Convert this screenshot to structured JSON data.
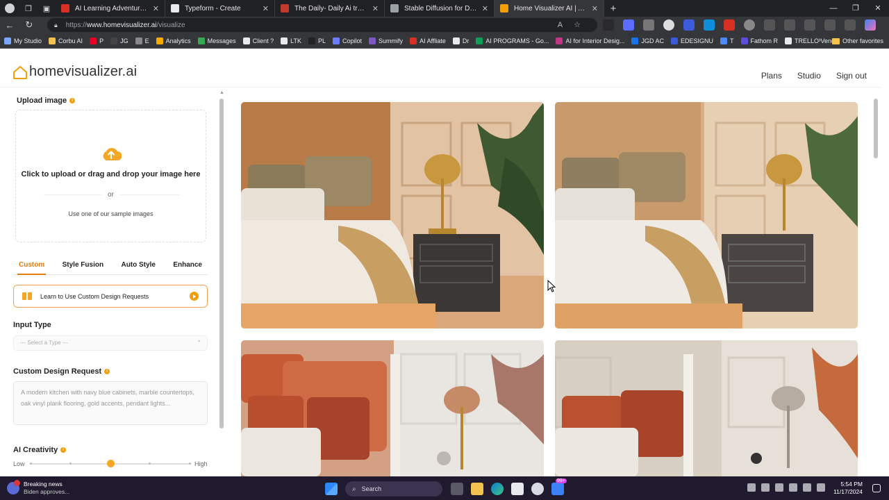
{
  "browser": {
    "tabs": [
      {
        "title": "AI Learning Adventure Guide",
        "color": "#d93025"
      },
      {
        "title": "Typeform - Create",
        "color": "#e8eaed"
      },
      {
        "title": "The Daily- Daily Ai training for int",
        "color": "#c0392b"
      },
      {
        "title": "Stable Diffusion for Designers",
        "color": "#9aa0a6"
      },
      {
        "title": "Home Visualizer AI | AI Inter",
        "color": "#f59e0b",
        "active": true
      }
    ],
    "url_scheme": "https://",
    "url_host": "www.homevisualizer.ai",
    "url_path": "/visualize",
    "bookmarks": [
      {
        "label": "My Studio",
        "color": "#7aa7ff"
      },
      {
        "label": "Corbu AI",
        "color": "#f2c14e"
      },
      {
        "label": "P",
        "color": "#e60023"
      },
      {
        "label": "JG",
        "color": "#444"
      },
      {
        "label": "E",
        "color": "#888"
      },
      {
        "label": "Analytics",
        "color": "#f9ab00"
      },
      {
        "label": "Messages",
        "color": "#34a853"
      },
      {
        "label": "Client ?",
        "color": "#e8eaed"
      },
      {
        "label": "LTK",
        "color": "#e8eaed"
      },
      {
        "label": "PL",
        "color": "#222"
      },
      {
        "label": "Copilot",
        "color": "#6b7cff"
      },
      {
        "label": "Summify",
        "color": "#7e57c2"
      },
      {
        "label": "AI Affliate",
        "color": "#d93025"
      },
      {
        "label": "Dr",
        "color": "#e8eaed"
      },
      {
        "label": "AI PROGRAMS - Go...",
        "color": "#0f9d58"
      },
      {
        "label": "AI for Interior Desig...",
        "color": "#c13584"
      },
      {
        "label": "JGD AC",
        "color": "#1a73e8"
      },
      {
        "label": "EDESIGNU",
        "color": "#3b5bdb"
      },
      {
        "label": "T",
        "color": "#4c8bf5"
      },
      {
        "label": "Fathom R",
        "color": "#5b4fe0"
      },
      {
        "label": "TRELLO Vend",
        "color": "#e8eaed"
      }
    ],
    "other_favorites": "Other favorites"
  },
  "site": {
    "logo": "homevisualizer.ai",
    "nav": [
      "Plans",
      "Studio",
      "Sign out"
    ]
  },
  "sidebar": {
    "upload_label": "Upload image",
    "upload_main": "Click to upload or drag and drop your image here",
    "or": "or",
    "sample": "Use one of our sample images",
    "modes": [
      "Custom",
      "Style Fusion",
      "Auto Style",
      "Enhance"
    ],
    "active_mode": "Custom",
    "learn": "Learn to Use Custom Design Requests",
    "input_type_label": "Input Type",
    "input_type_placeholder": "--- Select a Type ---",
    "custom_label": "Custom Design Request",
    "custom_placeholder": "A modern kitchen with navy blue cabinets, marble countertops, oak vinyl plank flooring, gold accents, pendant lights...",
    "creativity_label": "AI Creativity",
    "low": "Low",
    "high": "High",
    "creativity_level": 0.5
  },
  "taskbar": {
    "news_title": "Breaking news",
    "news_sub": "Biden approves...",
    "search": "Search",
    "badge": "99+",
    "time": "5:54 PM",
    "date": "11/17/2024"
  }
}
